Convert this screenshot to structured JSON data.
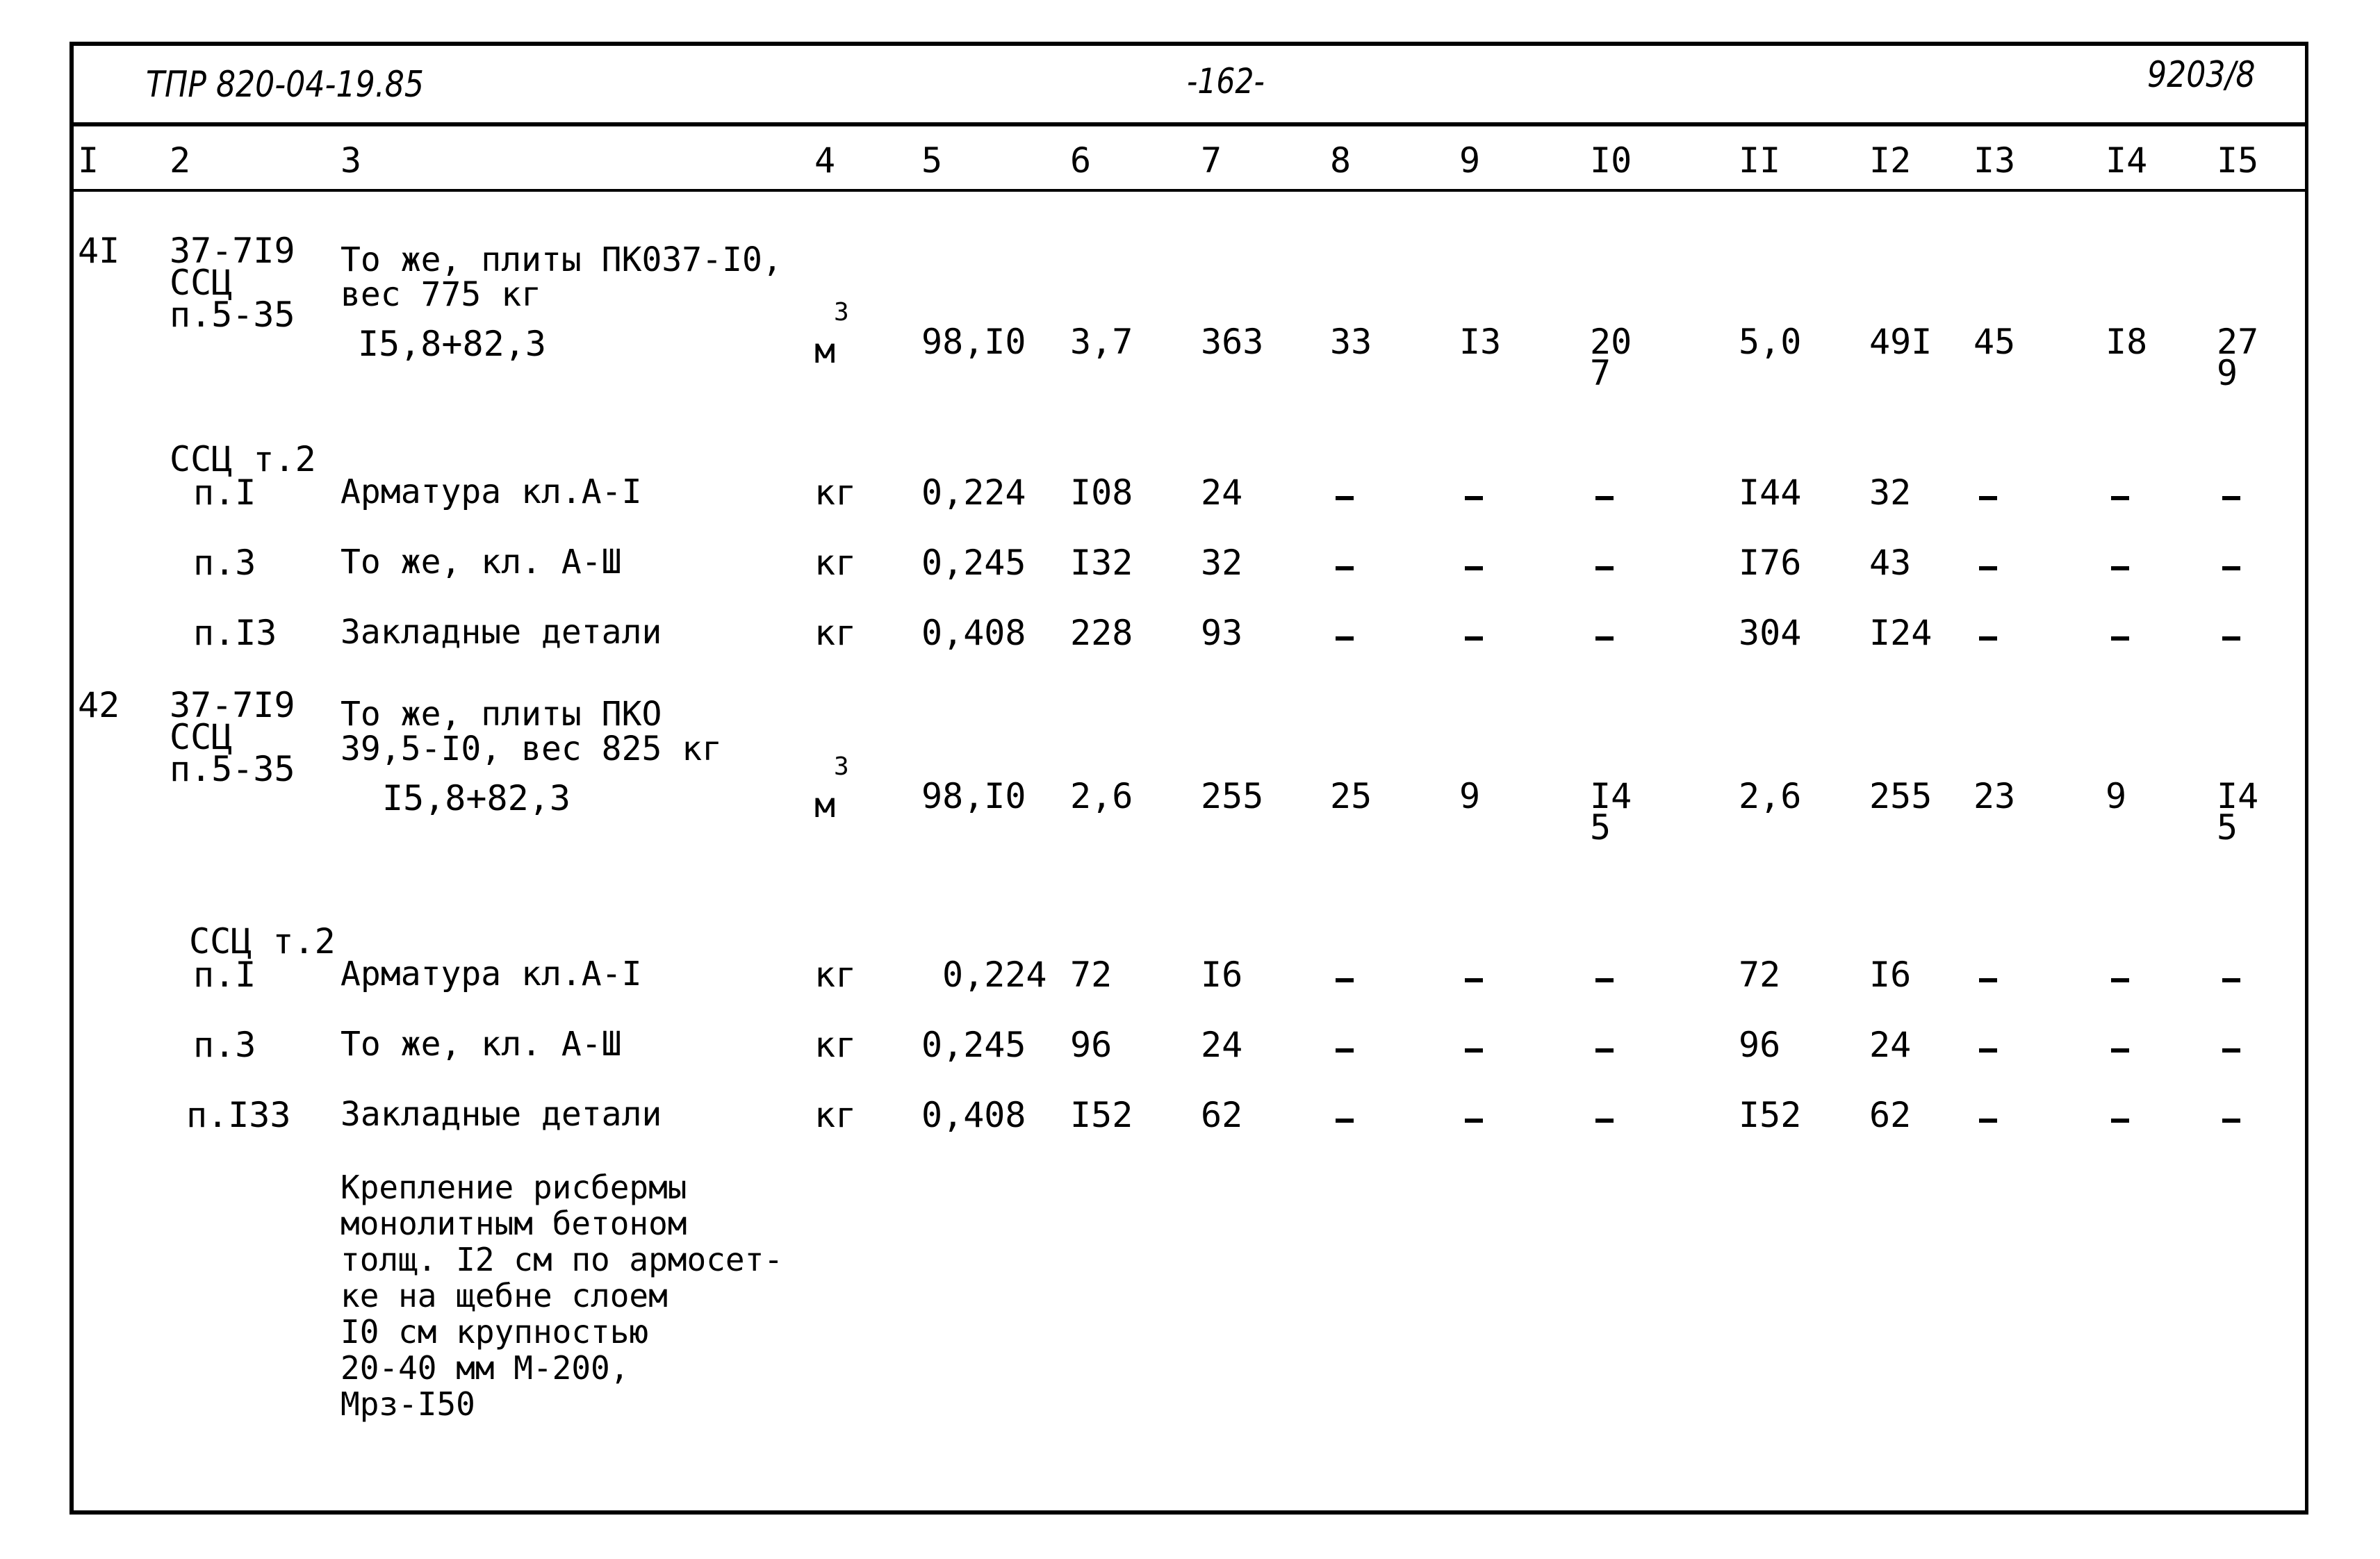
{
  "header": {
    "doc_code": "ТПР 820-04-19.85",
    "page_number": "-162-",
    "sheet_code": "9203/8"
  },
  "columns": [
    "I",
    "2",
    "3",
    "4",
    "5",
    "6",
    "7",
    "8",
    "9",
    "I0",
    "II",
    "I2",
    "I3",
    "I4",
    "I5"
  ],
  "sections": [
    {
      "no": "4I",
      "ref_lines": [
        "37-7I9",
        "ССЦ",
        "п.5-35"
      ],
      "desc_lines": [
        "То же, плиты ПК037-I0,",
        "вес 775 кг"
      ],
      "formula": "I5,8+82,3",
      "unit": "м",
      "unit_sup": "3",
      "values": [
        "98,I0",
        "3,7",
        "363",
        "33",
        "I3",
        "20\n7",
        "5,0",
        "49I",
        "45",
        "I8",
        "27\n9"
      ],
      "sub_header": "ССЦ т.2",
      "sub_rows": [
        {
          "ref": "п.I",
          "desc": "Арматура кл.А-I",
          "unit": "кг",
          "values": [
            "0,224",
            "I08",
            "24",
            "–",
            "–",
            "–",
            "I44",
            "32",
            "–",
            "–",
            "–"
          ]
        },
        {
          "ref": "п.3",
          "desc": "То же, кл. А-Ш",
          "unit": "кг",
          "values": [
            "0,245",
            "I32",
            "32",
            "–",
            "–",
            "–",
            "I76",
            "43",
            "–",
            "–",
            "–"
          ]
        },
        {
          "ref": "п.I3",
          "desc": "Закладные детали",
          "unit": "кг",
          "values": [
            "0,408",
            "228",
            "93",
            "–",
            "–",
            "–",
            "304",
            "I24",
            "–",
            "–",
            "–"
          ]
        }
      ]
    },
    {
      "no": "42",
      "ref_lines": [
        "37-7I9",
        "ССЦ",
        "п.5-35"
      ],
      "desc_lines": [
        "То же, плиты ПКО",
        "39,5-I0, вес 825 кг"
      ],
      "formula": "I5,8+82,3",
      "unit": "м",
      "unit_sup": "3",
      "values": [
        "98,I0",
        "2,6",
        "255",
        "25",
        "9",
        "I4\n5",
        "2,6",
        "255",
        "23",
        "9",
        "I4\n5"
      ],
      "sub_header": "ССЦ т.2",
      "sub_rows": [
        {
          "ref": "п.I",
          "desc": "Арматура кл.А-I",
          "unit": "кг",
          "values": [
            "0,224",
            "72",
            "I6",
            "–",
            "–",
            "–",
            "72",
            "I6",
            "–",
            "–",
            "–"
          ]
        },
        {
          "ref": "п.3",
          "desc": "То же, кл. А-Ш",
          "unit": "кг",
          "values": [
            "0,245",
            "96",
            "24",
            "–",
            "–",
            "–",
            "96",
            "24",
            "–",
            "–",
            "–"
          ]
        },
        {
          "ref": "п.I33",
          "desc": "Закладные детали",
          "unit": "кг",
          "values": [
            "0,408",
            "I52",
            "62",
            "–",
            "–",
            "–",
            "I52",
            "62",
            "–",
            "–",
            "–"
          ]
        }
      ]
    }
  ],
  "note_lines": [
    "Крепление рисбермы",
    "монолитным бетоном",
    "толщ. I2 см по армосет-",
    "ке на щебне слоем",
    "I0 см крупностью",
    "20-40 мм М-200,",
    "Мрз-I50"
  ]
}
